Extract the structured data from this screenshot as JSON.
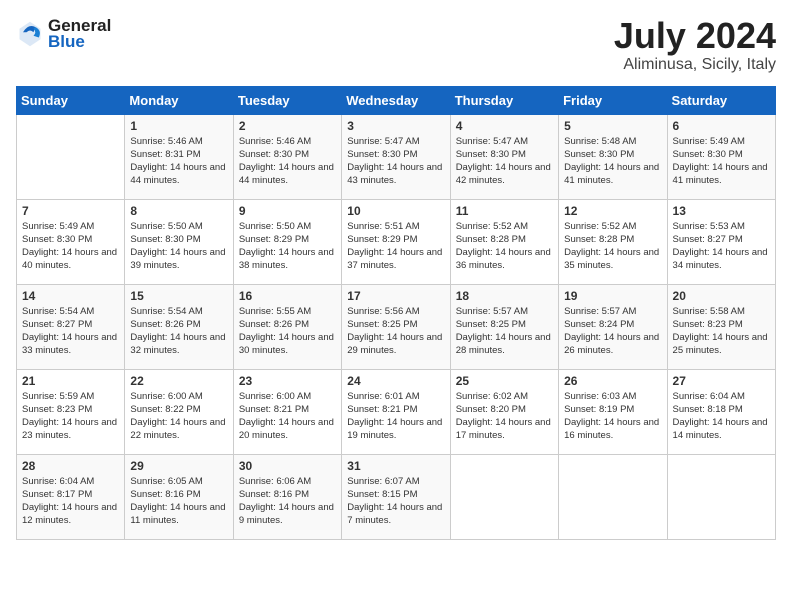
{
  "header": {
    "logo": {
      "general": "General",
      "blue": "Blue"
    },
    "title": "July 2024",
    "subtitle": "Aliminusa, Sicily, Italy"
  },
  "weekdays": [
    "Sunday",
    "Monday",
    "Tuesday",
    "Wednesday",
    "Thursday",
    "Friday",
    "Saturday"
  ],
  "weeks": [
    [
      {
        "day": null,
        "sunrise": null,
        "sunset": null,
        "daylight": null
      },
      {
        "day": "1",
        "sunrise": "5:46 AM",
        "sunset": "8:31 PM",
        "daylight": "14 hours and 44 minutes."
      },
      {
        "day": "2",
        "sunrise": "5:46 AM",
        "sunset": "8:30 PM",
        "daylight": "14 hours and 44 minutes."
      },
      {
        "day": "3",
        "sunrise": "5:47 AM",
        "sunset": "8:30 PM",
        "daylight": "14 hours and 43 minutes."
      },
      {
        "day": "4",
        "sunrise": "5:47 AM",
        "sunset": "8:30 PM",
        "daylight": "14 hours and 42 minutes."
      },
      {
        "day": "5",
        "sunrise": "5:48 AM",
        "sunset": "8:30 PM",
        "daylight": "14 hours and 41 minutes."
      },
      {
        "day": "6",
        "sunrise": "5:49 AM",
        "sunset": "8:30 PM",
        "daylight": "14 hours and 41 minutes."
      }
    ],
    [
      {
        "day": "7",
        "sunrise": "5:49 AM",
        "sunset": "8:30 PM",
        "daylight": "14 hours and 40 minutes."
      },
      {
        "day": "8",
        "sunrise": "5:50 AM",
        "sunset": "8:30 PM",
        "daylight": "14 hours and 39 minutes."
      },
      {
        "day": "9",
        "sunrise": "5:50 AM",
        "sunset": "8:29 PM",
        "daylight": "14 hours and 38 minutes."
      },
      {
        "day": "10",
        "sunrise": "5:51 AM",
        "sunset": "8:29 PM",
        "daylight": "14 hours and 37 minutes."
      },
      {
        "day": "11",
        "sunrise": "5:52 AM",
        "sunset": "8:28 PM",
        "daylight": "14 hours and 36 minutes."
      },
      {
        "day": "12",
        "sunrise": "5:52 AM",
        "sunset": "8:28 PM",
        "daylight": "14 hours and 35 minutes."
      },
      {
        "day": "13",
        "sunrise": "5:53 AM",
        "sunset": "8:27 PM",
        "daylight": "14 hours and 34 minutes."
      }
    ],
    [
      {
        "day": "14",
        "sunrise": "5:54 AM",
        "sunset": "8:27 PM",
        "daylight": "14 hours and 33 minutes."
      },
      {
        "day": "15",
        "sunrise": "5:54 AM",
        "sunset": "8:26 PM",
        "daylight": "14 hours and 32 minutes."
      },
      {
        "day": "16",
        "sunrise": "5:55 AM",
        "sunset": "8:26 PM",
        "daylight": "14 hours and 30 minutes."
      },
      {
        "day": "17",
        "sunrise": "5:56 AM",
        "sunset": "8:25 PM",
        "daylight": "14 hours and 29 minutes."
      },
      {
        "day": "18",
        "sunrise": "5:57 AM",
        "sunset": "8:25 PM",
        "daylight": "14 hours and 28 minutes."
      },
      {
        "day": "19",
        "sunrise": "5:57 AM",
        "sunset": "8:24 PM",
        "daylight": "14 hours and 26 minutes."
      },
      {
        "day": "20",
        "sunrise": "5:58 AM",
        "sunset": "8:23 PM",
        "daylight": "14 hours and 25 minutes."
      }
    ],
    [
      {
        "day": "21",
        "sunrise": "5:59 AM",
        "sunset": "8:23 PM",
        "daylight": "14 hours and 23 minutes."
      },
      {
        "day": "22",
        "sunrise": "6:00 AM",
        "sunset": "8:22 PM",
        "daylight": "14 hours and 22 minutes."
      },
      {
        "day": "23",
        "sunrise": "6:00 AM",
        "sunset": "8:21 PM",
        "daylight": "14 hours and 20 minutes."
      },
      {
        "day": "24",
        "sunrise": "6:01 AM",
        "sunset": "8:21 PM",
        "daylight": "14 hours and 19 minutes."
      },
      {
        "day": "25",
        "sunrise": "6:02 AM",
        "sunset": "8:20 PM",
        "daylight": "14 hours and 17 minutes."
      },
      {
        "day": "26",
        "sunrise": "6:03 AM",
        "sunset": "8:19 PM",
        "daylight": "14 hours and 16 minutes."
      },
      {
        "day": "27",
        "sunrise": "6:04 AM",
        "sunset": "8:18 PM",
        "daylight": "14 hours and 14 minutes."
      }
    ],
    [
      {
        "day": "28",
        "sunrise": "6:04 AM",
        "sunset": "8:17 PM",
        "daylight": "14 hours and 12 minutes."
      },
      {
        "day": "29",
        "sunrise": "6:05 AM",
        "sunset": "8:16 PM",
        "daylight": "14 hours and 11 minutes."
      },
      {
        "day": "30",
        "sunrise": "6:06 AM",
        "sunset": "8:16 PM",
        "daylight": "14 hours and 9 minutes."
      },
      {
        "day": "31",
        "sunrise": "6:07 AM",
        "sunset": "8:15 PM",
        "daylight": "14 hours and 7 minutes."
      },
      {
        "day": null,
        "sunrise": null,
        "sunset": null,
        "daylight": null
      },
      {
        "day": null,
        "sunrise": null,
        "sunset": null,
        "daylight": null
      },
      {
        "day": null,
        "sunrise": null,
        "sunset": null,
        "daylight": null
      }
    ]
  ]
}
